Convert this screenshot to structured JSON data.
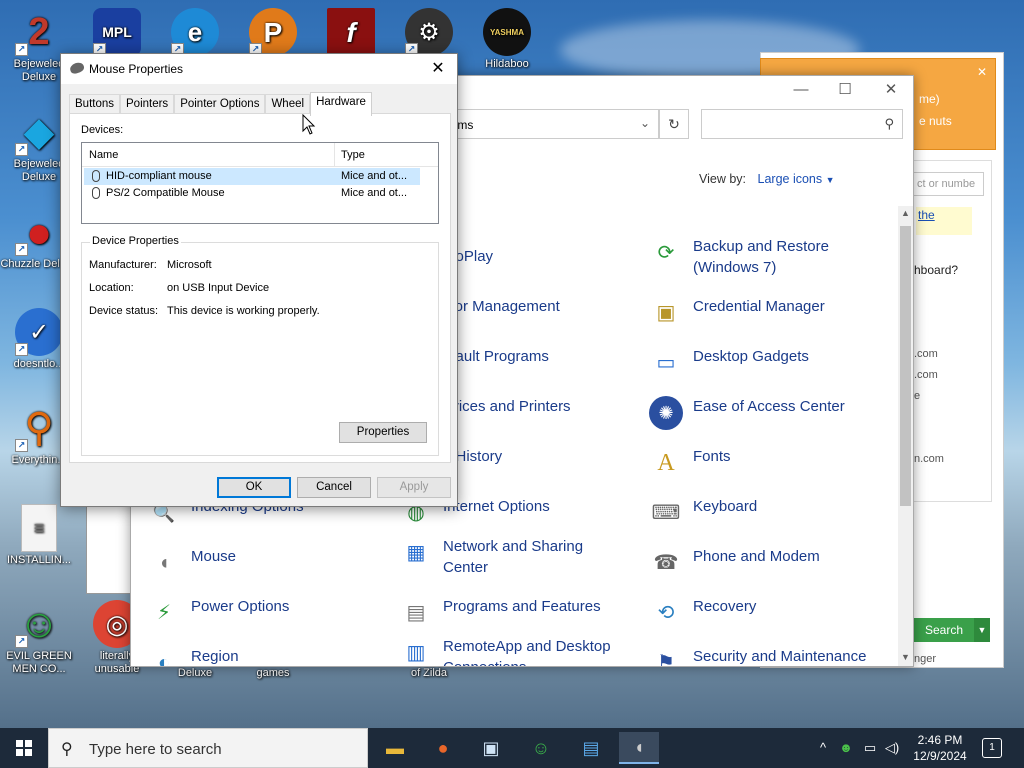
{
  "desktop": {
    "icons": [
      {
        "label": "Bejeweled Deluxe",
        "glyph": "2",
        "color": "#c0392b"
      },
      {
        "label": "MPL",
        "glyph": "MPL",
        "color": "#1a3fa0"
      },
      {
        "label": "",
        "glyph": "e",
        "color": "#1e8ad6"
      },
      {
        "label": "",
        "glyph": "P",
        "color": "#e07a1a"
      },
      {
        "label": "",
        "glyph": "f",
        "color": "#8a1010"
      },
      {
        "label": "",
        "glyph": "⚙",
        "color": "#333333"
      },
      {
        "label": "Hildaboo",
        "glyph": "YASHMA",
        "color": "#111111"
      },
      {
        "label": "Bejeweled Deluxe",
        "glyph": "◆",
        "color": "#1aa6e0"
      },
      {
        "label": "Chuzzle Deluxe",
        "glyph": "●",
        "color": "#d02020"
      },
      {
        "label": "doesntlo...",
        "glyph": "✓",
        "color": "#2a6fd0"
      },
      {
        "label": "Everythin...",
        "glyph": "⚲",
        "color": "#e06a10"
      },
      {
        "label": "INSTALLIN...",
        "glyph": "≡",
        "color": "#f4f4f4"
      },
      {
        "label": "EVIL GREEN MEN CO...",
        "glyph": "☺",
        "color": "#2aa040"
      },
      {
        "label": "literally unusable",
        "glyph": "◎",
        "color": "#dd4433"
      },
      {
        "label": "Deluxe",
        "glyph": "",
        "color": "#4a7fb0"
      },
      {
        "label": "games",
        "glyph": "",
        "color": "#4a7fb0"
      },
      {
        "label": "of Zilda",
        "glyph": "",
        "color": "#4a7fb0"
      }
    ]
  },
  "control_panel": {
    "address_text": "l Items",
    "view_by_label": "View by:",
    "view_by_value": "Large icons",
    "items": [
      {
        "label": "utoPlay",
        "icon": "autoplay-icon",
        "glyph": ""
      },
      {
        "label": "Backup and Restore (Windows 7)",
        "icon": "backup-restore-icon",
        "glyph": "⟳"
      },
      {
        "label": "olor Management",
        "icon": "color-management-icon",
        "glyph": ""
      },
      {
        "label": "Credential Manager",
        "icon": "credential-manager-icon",
        "glyph": "▣"
      },
      {
        "label": "efault Programs",
        "icon": "default-programs-icon",
        "glyph": ""
      },
      {
        "label": "Desktop Gadgets",
        "icon": "desktop-gadgets-icon",
        "glyph": "▭"
      },
      {
        "label": "evices and Printers",
        "icon": "devices-printers-icon",
        "glyph": ""
      },
      {
        "label": "Ease of Access Center",
        "icon": "ease-of-access-icon",
        "glyph": "✺"
      },
      {
        "label": "e History",
        "icon": "file-history-icon",
        "glyph": ""
      },
      {
        "label": "Fonts",
        "icon": "fonts-icon",
        "glyph": "A"
      },
      {
        "label": "Indexing Options",
        "icon": "indexing-options-icon",
        "glyph": "🔍"
      },
      {
        "label": "Internet Options",
        "icon": "internet-options-icon",
        "glyph": "◍"
      },
      {
        "label": "Keyboard",
        "icon": "keyboard-icon",
        "glyph": "⌨"
      },
      {
        "label": "Mouse",
        "icon": "mouse-icon",
        "glyph": "◖"
      },
      {
        "label": "Network and Sharing Center",
        "icon": "network-sharing-icon",
        "glyph": "▦"
      },
      {
        "label": "Phone and Modem",
        "icon": "phone-modem-icon",
        "glyph": "☎"
      },
      {
        "label": "Power Options",
        "icon": "power-options-icon",
        "glyph": "⚡"
      },
      {
        "label": "Programs and Features",
        "icon": "programs-features-icon",
        "glyph": "▤"
      },
      {
        "label": "Recovery",
        "icon": "recovery-icon",
        "glyph": "⟲"
      },
      {
        "label": "Region",
        "icon": "region-icon",
        "glyph": "◐"
      },
      {
        "label": "RemoteApp and Desktop Connections",
        "icon": "remoteapp-icon",
        "glyph": "▥"
      },
      {
        "label": "Security and Maintenance",
        "icon": "security-maintenance-icon",
        "glyph": "⚑"
      }
    ]
  },
  "right_window": {
    "orange_lines": [
      "me)",
      "e nuts"
    ],
    "input_placeholder": "ct or numbe",
    "link_text": "the",
    "texts": [
      "hboard?",
      ".com",
      ".com",
      "e",
      "n.com",
      "nger"
    ],
    "search_label": "Search"
  },
  "dialog": {
    "title": "Mouse Properties",
    "tabs": [
      "Buttons",
      "Pointers",
      "Pointer Options",
      "Wheel",
      "Hardware"
    ],
    "active_tab": "Hardware",
    "devices_label": "Devices:",
    "columns": {
      "name": "Name",
      "type": "Type"
    },
    "devices": [
      {
        "name": "HID-compliant mouse",
        "type": "Mice and ot..."
      },
      {
        "name": "PS/2 Compatible Mouse",
        "type": "Mice and ot..."
      }
    ],
    "device_properties_title": "Device Properties",
    "manufacturer_label": "Manufacturer:",
    "manufacturer_value": "Microsoft",
    "location_label": "Location:",
    "location_value": "on USB Input Device",
    "status_label": "Device status:",
    "status_value": "This device is working properly.",
    "properties_button": "Properties",
    "ok_button": "OK",
    "cancel_button": "Cancel",
    "apply_button": "Apply"
  },
  "taskbar": {
    "search_placeholder": "Type here to search",
    "time": "2:46 PM",
    "date": "12/9/2024",
    "notification_count": "1"
  }
}
